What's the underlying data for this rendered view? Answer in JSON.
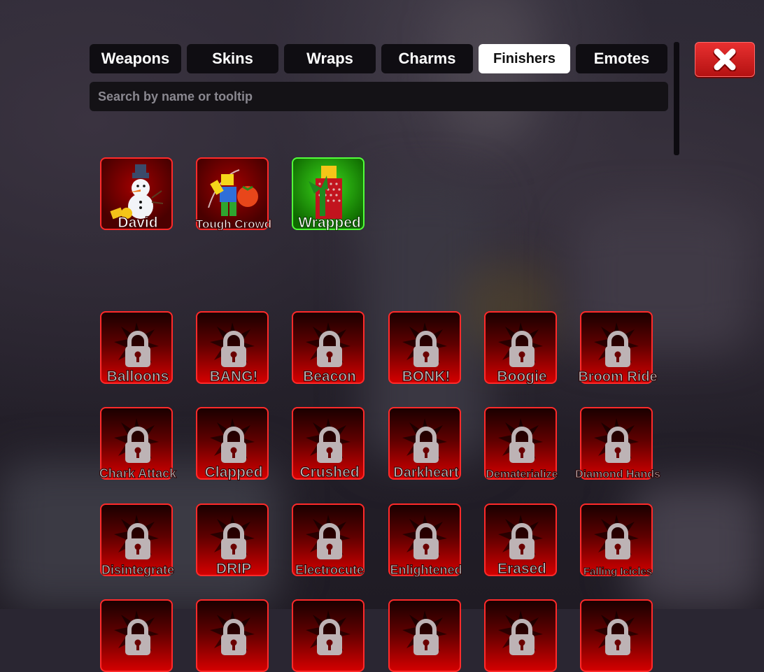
{
  "tabs": [
    {
      "label": "Weapons",
      "active": false
    },
    {
      "label": "Skins",
      "active": false
    },
    {
      "label": "Wraps",
      "active": false
    },
    {
      "label": "Charms",
      "active": false
    },
    {
      "label": "Finishers",
      "active": true
    },
    {
      "label": "Emotes",
      "active": false
    }
  ],
  "search": {
    "placeholder": "Search by name or tooltip",
    "value": ""
  },
  "owned": [
    {
      "name": "David",
      "color": "red",
      "icon": "snowman-art"
    },
    {
      "name": "Tough Crowd",
      "color": "red",
      "icon": "tomato-thrower-art"
    },
    {
      "name": "Wrapped",
      "color": "green",
      "icon": "gift-wrapped-art"
    }
  ],
  "locked": [
    "Balloons",
    "BANG!",
    "Beacon",
    "BONK!",
    "Boogie",
    "Broom Ride",
    "Chark Attack",
    "Clapped",
    "Crushed",
    "Darkheart",
    "Dematerialize",
    "Diamond Hands",
    "Disintegrate",
    "DRIP",
    "Electrocute",
    "Enlightened",
    "Erased",
    "Falling Icicles",
    "",
    "",
    "",
    "",
    "",
    ""
  ],
  "colors": {
    "accent_red": "#ff2a2a",
    "owned_green": "#52ff3a",
    "tab_active": "#ffffff"
  }
}
